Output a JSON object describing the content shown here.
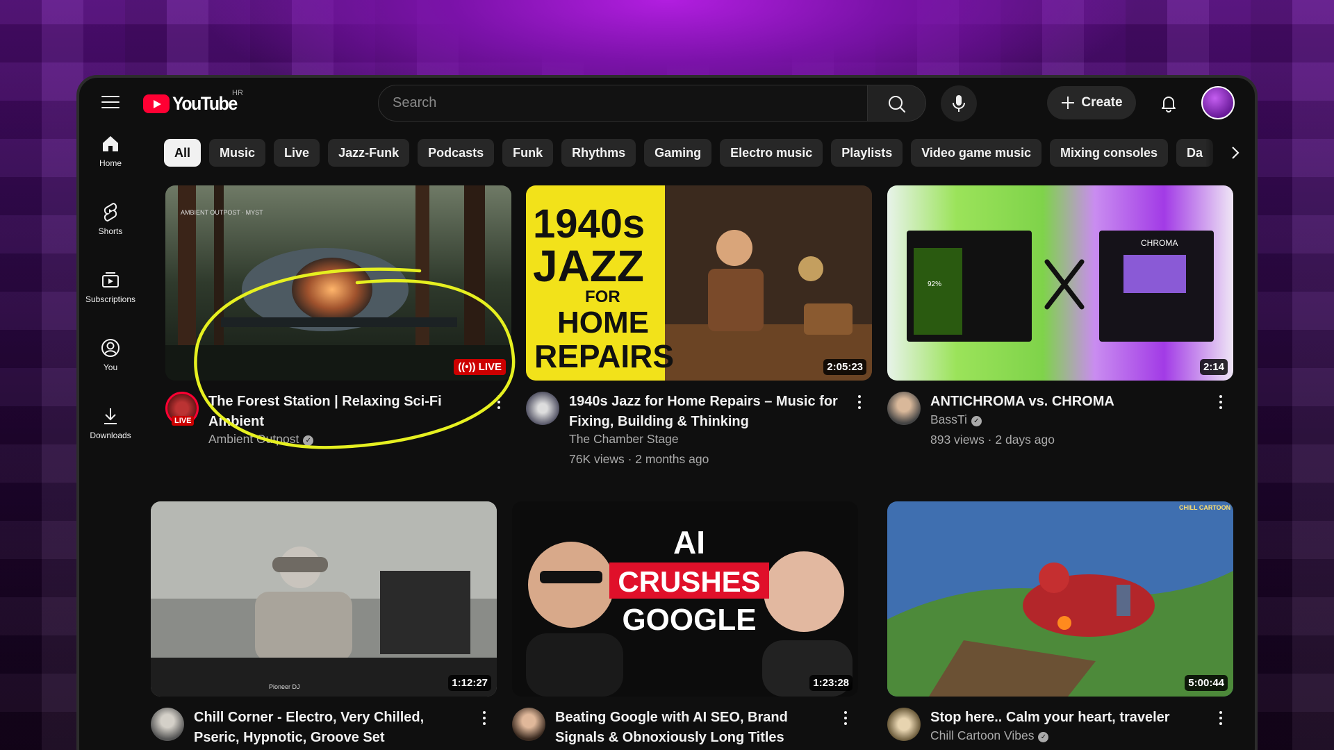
{
  "header": {
    "logo_text": "YouTube",
    "region": "HR",
    "search_placeholder": "Search",
    "create_label": "Create"
  },
  "sidebar": {
    "items": [
      {
        "label": "Home",
        "icon": "home-icon"
      },
      {
        "label": "Shorts",
        "icon": "shorts-icon"
      },
      {
        "label": "Subscriptions",
        "icon": "subscriptions-icon"
      },
      {
        "label": "You",
        "icon": "you-icon"
      },
      {
        "label": "Downloads",
        "icon": "download-icon"
      }
    ]
  },
  "chips": [
    "All",
    "Music",
    "Live",
    "Jazz-Funk",
    "Podcasts",
    "Funk",
    "Rhythms",
    "Gaming",
    "Electro music",
    "Playlists",
    "Video game music",
    "Mixing consoles",
    "Da"
  ],
  "videos": [
    {
      "title": "The Forest Station | Relaxing Sci-Fi Ambient",
      "channel": "Ambient Outpost",
      "verified": true,
      "stats": "",
      "badge": "LIVE",
      "avatar_badge": "LIVE",
      "thumb_text": "AMBIENT OUTPOST · MYST"
    },
    {
      "title": "1940s Jazz for Home Repairs – Music for Fixing, Building & Thinking",
      "channel": "The Chamber Stage",
      "verified": false,
      "stats": "76K views · 2 months ago",
      "duration": "2:05:23",
      "thumb_text": [
        "1940s",
        "JAZZ",
        "FOR",
        "HOME",
        "REPAIRS"
      ]
    },
    {
      "title": "ANTICHROMA vs. CHROMA",
      "channel": "BassTi",
      "verified": true,
      "stats": "893 views · 2 days ago",
      "duration": "2:14",
      "thumb_text": [
        "92%",
        "CHROMA"
      ]
    },
    {
      "title": "Chill Corner - Electro, Very Chilled, Pseric, Hypnotic, Groove Set",
      "channel": "",
      "verified": false,
      "stats": "",
      "duration": "1:12:27",
      "thumb_text": "Pioneer DJ"
    },
    {
      "title": "Beating Google with AI SEO, Brand Signals & Obnoxiously Long Titles",
      "channel": "",
      "verified": false,
      "stats": "",
      "duration": "1:23:28",
      "thumb_text": [
        "AI",
        "CRUSHES",
        "GOOGLE"
      ]
    },
    {
      "title": "Stop here.. Calm your heart, traveler",
      "channel": "Chill Cartoon Vibes",
      "verified": true,
      "stats": "",
      "duration": "5:00:44",
      "thumb_text": "CHILL CARTOON VIBES"
    }
  ],
  "colors": {
    "accent_red": "#ff0033",
    "highlight_yellow": "#e6f020",
    "bg": "#0f0f0f"
  }
}
